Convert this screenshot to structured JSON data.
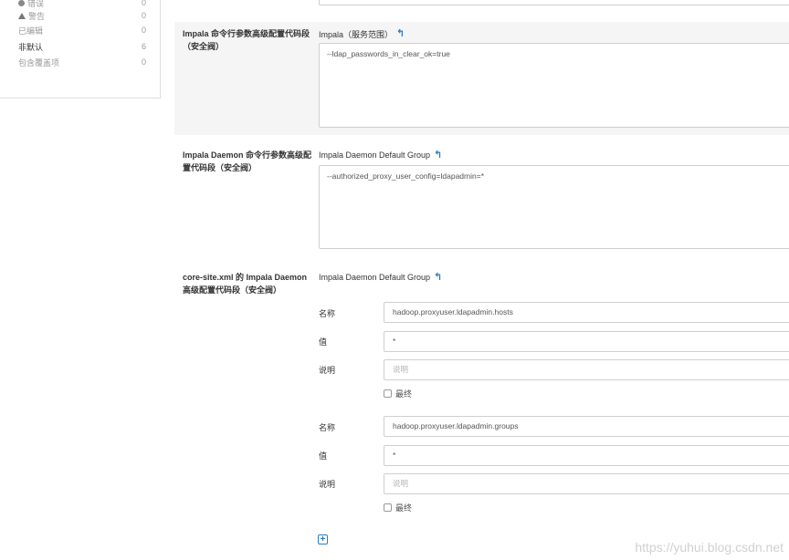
{
  "filters": [
    {
      "label": "错误",
      "count": "0",
      "icon": "error-icon"
    },
    {
      "label": "警告",
      "count": "0",
      "icon": "warning-icon"
    },
    {
      "label": "已编辑",
      "count": "0"
    },
    {
      "label": "非默认",
      "count": "6"
    },
    {
      "label": "包含覆盖项",
      "count": "0"
    }
  ],
  "sections": {
    "impala_cmd": {
      "label": "Impala 命令行参数高级配置代码段（安全阀）",
      "group": "Impala（服务范围）",
      "value": "--ldap_passwords_in_clear_ok=true"
    },
    "daemon_cmd": {
      "label": "Impala Daemon 命令行参数高级配置代码段（安全阀）",
      "group": "Impala Daemon Default Group",
      "value": "--authorized_proxy_user_config=ldapadmin=*"
    },
    "core_site": {
      "label": "core-site.xml 的 Impala Daemon 高级配置代码段（安全阀）",
      "group": "Impala Daemon Default Group",
      "name_label": "名称",
      "value_label": "值",
      "desc_label": "说明",
      "final_label": "最终",
      "entries": [
        {
          "name": "hadoop.proxyuser.ldapadmin.hosts",
          "value": "*",
          "desc_placeholder": "说明"
        },
        {
          "name": "hadoop.proxyuser.ldapadmin.groups",
          "value": "*",
          "desc_placeholder": "说明"
        }
      ]
    }
  },
  "undo_icon": "undo-arrow-icon",
  "add_icon": "plus-square-icon",
  "watermark": "https://yuhui.blog.csdn.net",
  "colors": {
    "accent": "#2a7dc4",
    "shaded_bg": "#f5f5f5",
    "border": "#cfcfcf"
  }
}
